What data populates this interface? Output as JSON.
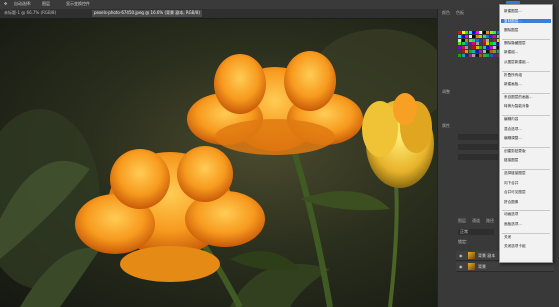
{
  "optbar": {
    "item1": "自动选择:",
    "item2": "图层",
    "item3": "显示变换控件"
  },
  "tabs": [
    {
      "label": "未标题-1 @ 66.7% (RGB/8)"
    },
    {
      "label": "pexels-photo-67450.jpeg @ 16.6% (背景 副本, RGB/8)"
    }
  ],
  "panel": {
    "tab_color": "颜色",
    "tab_swatches": "色板",
    "tab_adjust": "调整",
    "tab_props": "属性",
    "tab_layers": "图层",
    "tab_channels": "通道",
    "tab_paths": "路径",
    "blend": "正常",
    "opacity_label": "不透明度:",
    "opacity": "100%",
    "lock_label": "锁定:",
    "fill_label": "填充:",
    "fill": "100%"
  },
  "layers": [
    {
      "name": "背景 副本"
    },
    {
      "name": "背景"
    }
  ],
  "menu": {
    "items": [
      "新建图层...",
      "复制图层...",
      "删除图层",
      "删除隐藏图层",
      "新建组...",
      "从图层新建组...",
      "折叠所有组",
      "新建画板...",
      "来自图层的画板...",
      "转换为智能对象",
      "编辑内容",
      "混合选项...",
      "编辑调整...",
      "创建剪贴蒙版",
      "链接图层",
      "选择链接图层",
      "向下合并",
      "合并可见图层",
      "拼合图像",
      "动画选项",
      "面板选项...",
      "关闭",
      "关闭选项卡组"
    ],
    "highlighted": "复制图层..."
  },
  "colors": {
    "accent": "#3b7ed8",
    "panel_bg": "#393939",
    "menu_bg": "#f2f2f2"
  }
}
